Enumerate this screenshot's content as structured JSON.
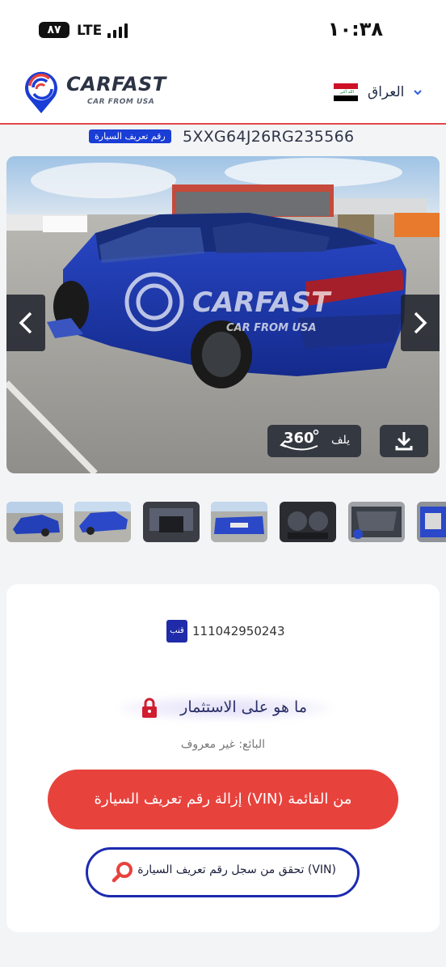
{
  "status_bar": {
    "battery": "٨٧",
    "network": "LTE",
    "time": "١٠:٣٨"
  },
  "header": {
    "brand_name": "CARFAST",
    "brand_tagline": "CAR FROM USA",
    "country": "العراق",
    "flag_colors": [
      "#ce1126",
      "#ffffff",
      "#000000"
    ]
  },
  "vin": {
    "badge_label": "رقم تعريف السيارة",
    "value": "5XXG64J26RG235566"
  },
  "gallery": {
    "spin_label": "يلف",
    "spin_icon": "360-rotate-icon",
    "download_icon": "download-icon",
    "prev_icon": "chevron-left-icon",
    "next_icon": "chevron-right-icon",
    "watermark_name": "CARFAST",
    "watermark_tagline": "CAR FROM USA",
    "thumbnail_count": 7
  },
  "card": {
    "lot_badge": "قنب",
    "lot_number": "111042950243",
    "investment_text": "ما هو على الاستثمار",
    "seller_text": "البائع: غير معروف",
    "remove_button": "إزالة رقم تعريف السيارة (VIN) من القائمة",
    "history_button": "تحقق من سجل رقم تعريف السيارة (VIN)"
  },
  "colors": {
    "accent_red": "#e8423d",
    "accent_blue": "#1c2bb0",
    "vin_badge_blue": "#1a3dd6"
  }
}
